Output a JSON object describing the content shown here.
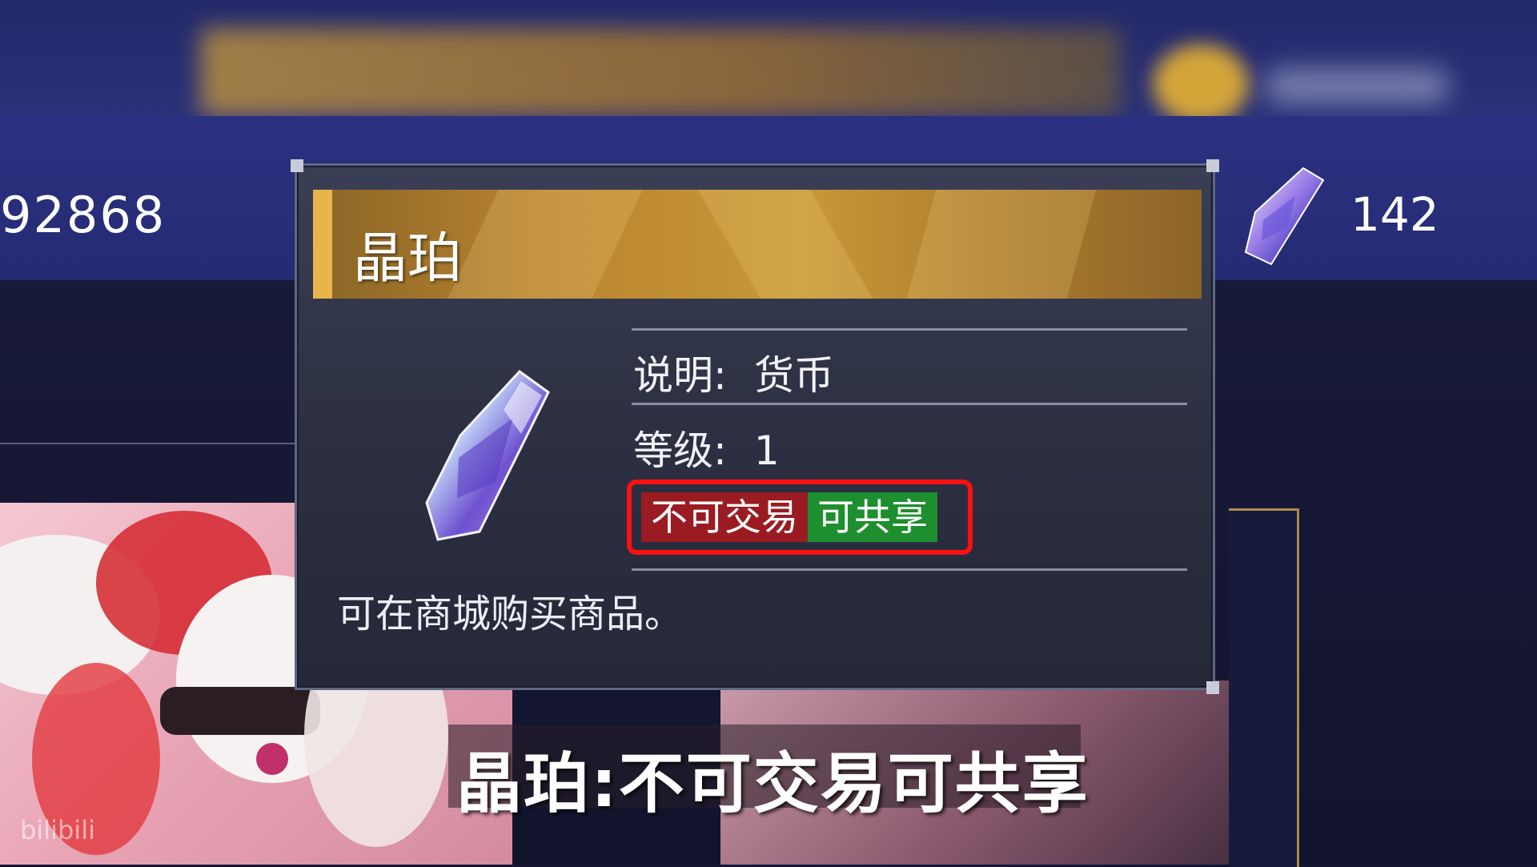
{
  "currency": {
    "left_amount": "92868",
    "right_amount": "142"
  },
  "tooltip": {
    "title": "晶珀",
    "rows": [
      {
        "label": "说明:",
        "value": "货币"
      },
      {
        "label": "等级:",
        "value": "1"
      }
    ],
    "tags": {
      "trade": "不可交易",
      "share": "可共享"
    },
    "description": "可在商城购买商品。"
  },
  "subtitle": "晶珀:不可交易可共享",
  "watermark": "bilibili",
  "colors": {
    "header_gold": "#c99838",
    "tag_red": "#9a1c22",
    "tag_green": "#1d8f2e",
    "highlight_box": "#ff1010"
  },
  "icons": {
    "crystal": "crystal-gem-icon"
  }
}
